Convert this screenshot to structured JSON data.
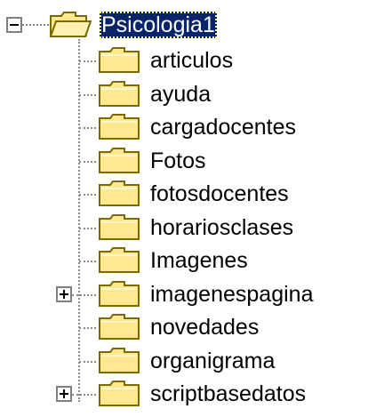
{
  "tree": {
    "root": {
      "label": "Psicologia1",
      "icon": "folder-open-icon",
      "expanded": true,
      "selected": true
    },
    "children": [
      {
        "label": "articulos",
        "icon": "folder-icon",
        "has_children": false
      },
      {
        "label": "ayuda",
        "icon": "folder-icon",
        "has_children": false
      },
      {
        "label": "cargadocentes",
        "icon": "folder-icon",
        "has_children": false
      },
      {
        "label": "Fotos",
        "icon": "folder-icon",
        "has_children": false
      },
      {
        "label": "fotosdocentes",
        "icon": "folder-icon",
        "has_children": false
      },
      {
        "label": "horariosclases",
        "icon": "folder-icon",
        "has_children": false
      },
      {
        "label": "Imagenes",
        "icon": "folder-icon",
        "has_children": false
      },
      {
        "label": "imagenespagina",
        "icon": "folder-icon",
        "has_children": true
      },
      {
        "label": "novedades",
        "icon": "folder-icon",
        "has_children": false
      },
      {
        "label": "organigrama",
        "icon": "folder-icon",
        "has_children": false
      },
      {
        "label": "scriptbasedatos",
        "icon": "folder-icon",
        "has_children": true
      }
    ]
  },
  "colors": {
    "selection_bg": "#0a246a",
    "selection_text": "#ffffff",
    "folder_fill": "#ffe88f",
    "folder_outline": "#7a6a00",
    "tree_line": "#8a8a8a"
  }
}
